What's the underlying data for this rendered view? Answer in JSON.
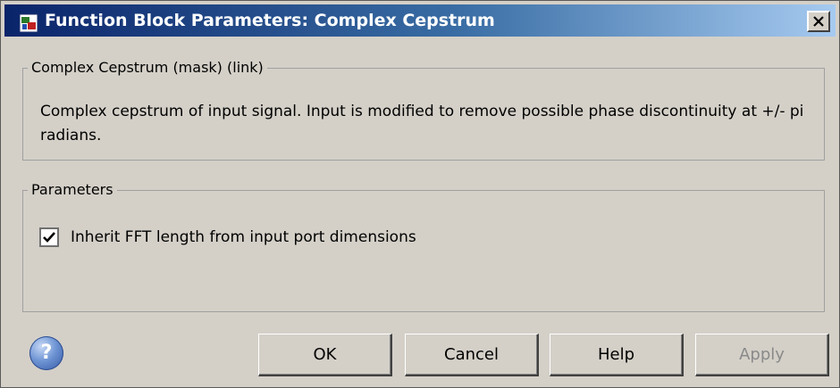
{
  "window": {
    "title": "Function Block Parameters: Complex Cepstrum",
    "close_icon": "close-icon",
    "app_icon": "simulink-block-icon"
  },
  "description_group": {
    "legend": "Complex Cepstrum (mask) (link)",
    "text": "Complex cepstrum of input signal.  Input is modified to remove possible phase discontinuity at +/- pi radians."
  },
  "parameters_group": {
    "legend": "Parameters",
    "inherit_fft": {
      "label": "Inherit FFT length from input port dimensions",
      "checked": true
    }
  },
  "footer": {
    "help_icon": "question-mark-icon",
    "buttons": {
      "ok": "OK",
      "cancel": "Cancel",
      "help": "Help",
      "apply": "Apply"
    },
    "apply_enabled": false
  },
  "colors": {
    "dialog_bg": "#d4d0c8",
    "title_gradient_start": "#0a246a",
    "title_gradient_end": "#a6caf0",
    "disabled_text": "#8a8a8a"
  }
}
